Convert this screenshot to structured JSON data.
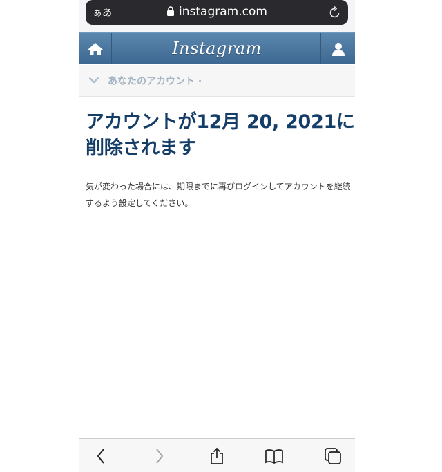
{
  "browser": {
    "aa_label": "ぁあ",
    "url": "instagram.com"
  },
  "header": {
    "logo_text": "Instagram"
  },
  "account_menu": {
    "label": "あなたのアカウント ·"
  },
  "notice": {
    "title": "アカウントが12月 20, 2021に削除されます",
    "body": "気が変わった場合には、期限までに再びログインしてアカウントを継続するよう設定してください。"
  },
  "colors": {
    "header_blue": "#3d6891",
    "title_navy": "#143e68",
    "muted_label": "#a3b3c4"
  }
}
